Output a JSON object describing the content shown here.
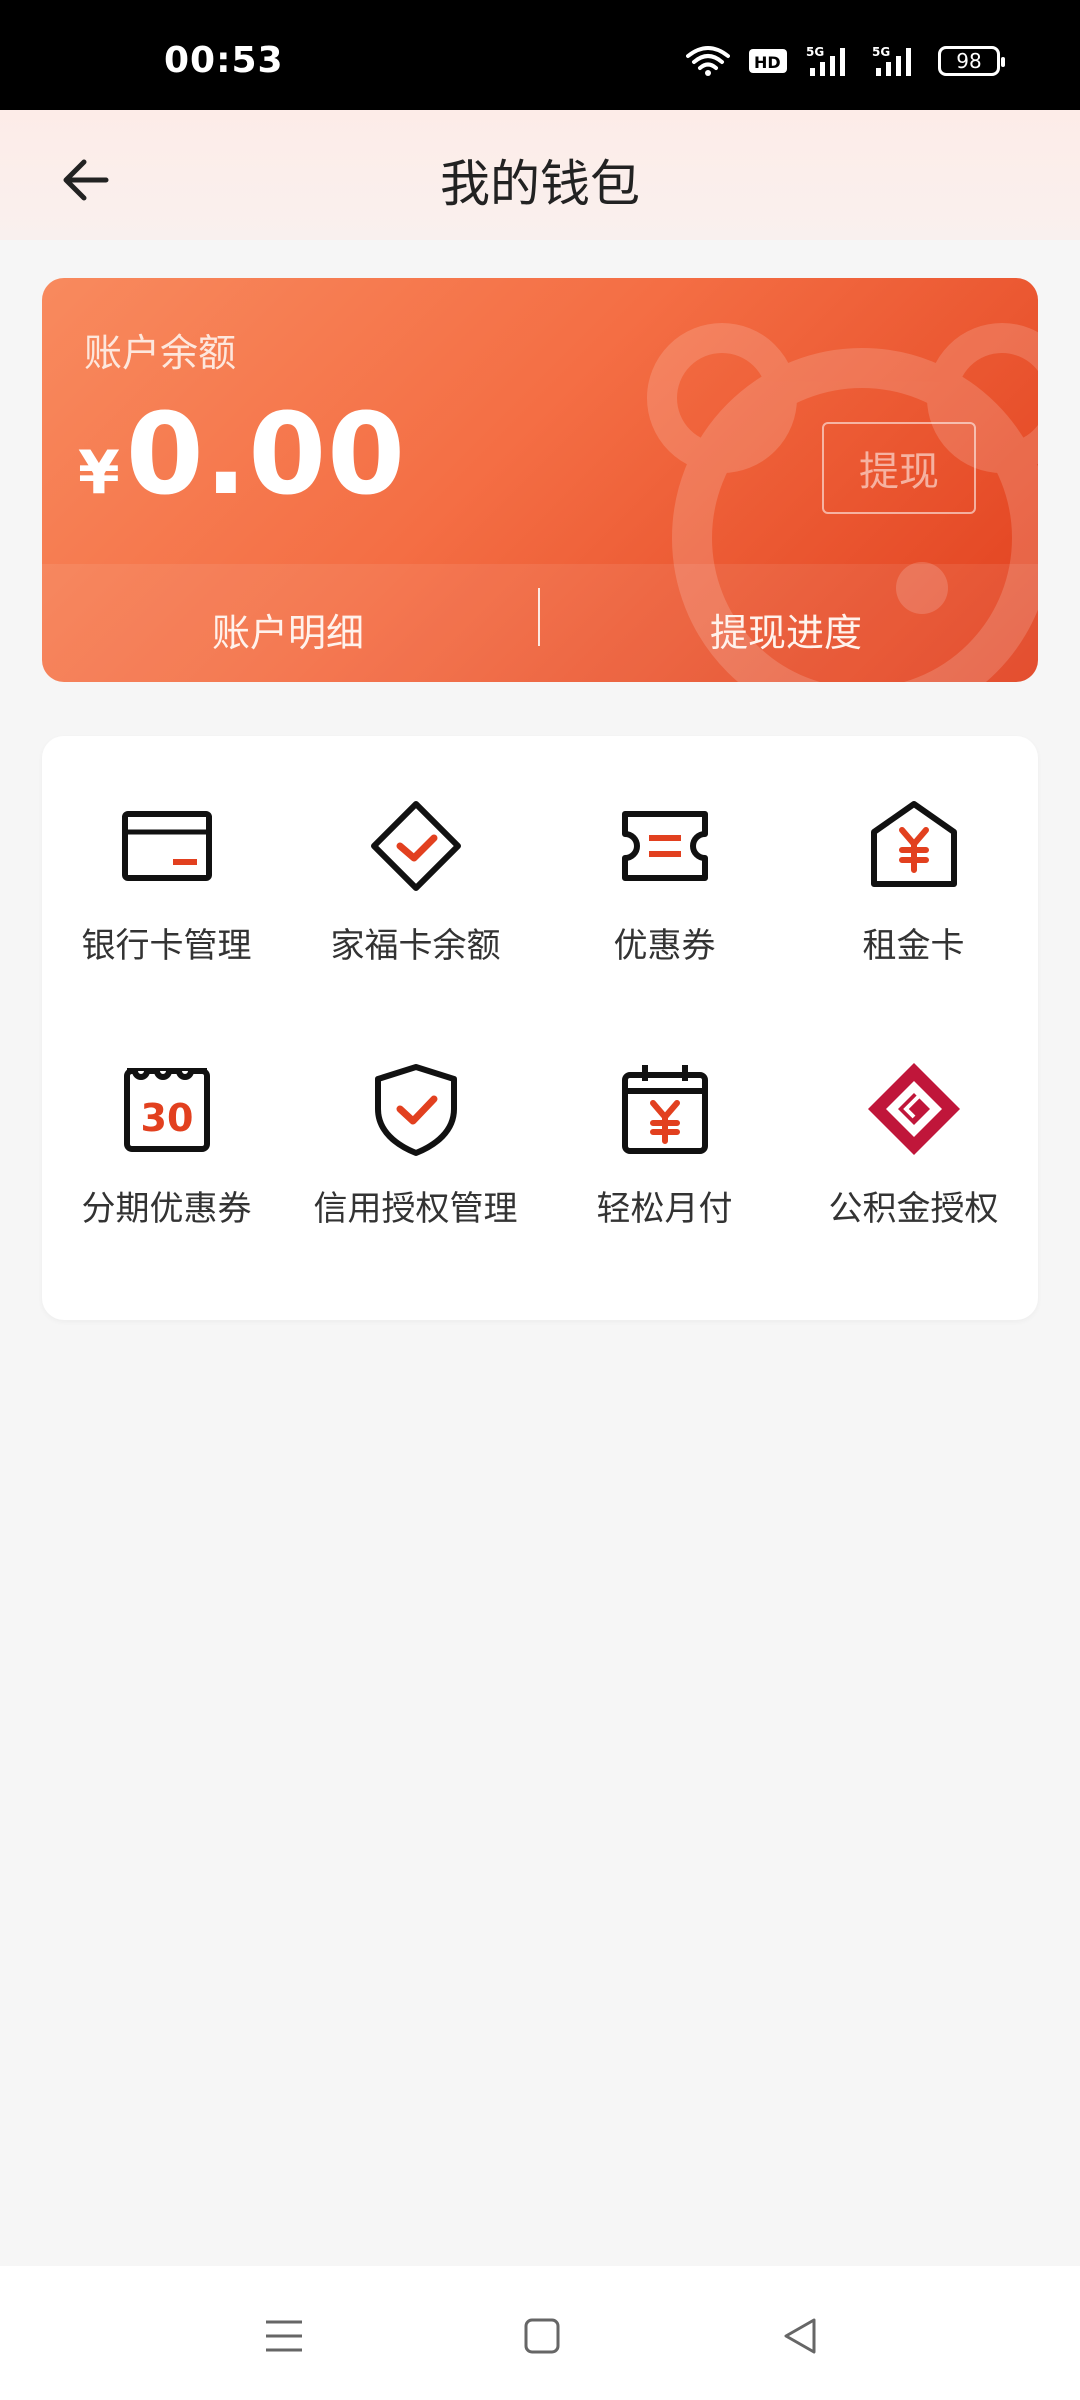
{
  "status_bar": {
    "time": "00:53",
    "battery": "98"
  },
  "header": {
    "title": "我的钱包"
  },
  "balance_card": {
    "label": "账户余额",
    "currency": "¥",
    "amount": "0.00",
    "withdraw_label": "提现",
    "detail_label": "账户明细",
    "progress_label": "提现进度"
  },
  "services": {
    "items": [
      {
        "label": "银行卡管理",
        "icon": "bank-card-icon"
      },
      {
        "label": "家福卡余额",
        "icon": "diamond-check-icon"
      },
      {
        "label": "优惠券",
        "icon": "coupon-icon"
      },
      {
        "label": "租金卡",
        "icon": "house-yuan-icon"
      },
      {
        "label": "分期优惠券",
        "icon": "calendar-30-icon"
      },
      {
        "label": "信用授权管理",
        "icon": "shield-check-icon"
      },
      {
        "label": "轻松月付",
        "icon": "calendar-yuan-icon"
      },
      {
        "label": "公积金授权",
        "icon": "housing-fund-logo-icon"
      }
    ],
    "calendar_number": "30"
  },
  "colors": {
    "accent": "#e2401f",
    "card_start": "#f88a5e",
    "card_end": "#e1401e",
    "fund_logo": "#c0163a"
  }
}
